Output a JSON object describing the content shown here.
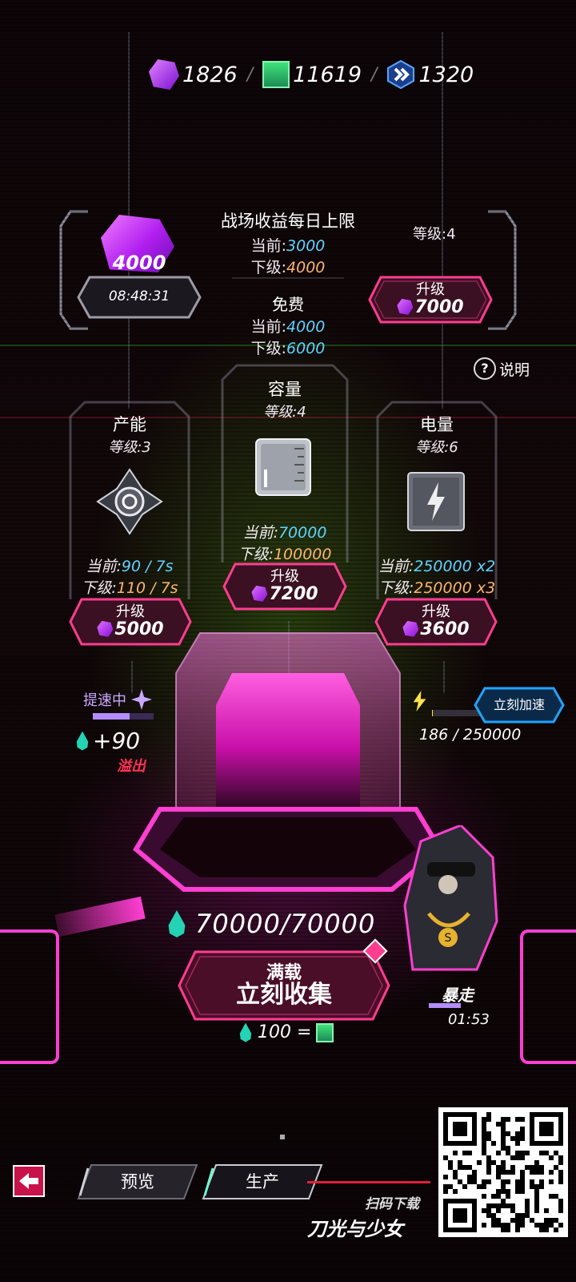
{
  "resources": {
    "gems": "1826",
    "tickets": "11619",
    "chips": "1320",
    "sep": "/"
  },
  "battlefield": {
    "title": "战场收益每日上限",
    "cur_label": "当前:",
    "cur_value": "3000",
    "next_label": "下级:",
    "next_value": "4000",
    "free_label": "免费",
    "free_cur_label": "当前:",
    "free_cur_value": "4000",
    "free_next_label": "下级:",
    "free_next_value": "6000",
    "level": "等级:4",
    "gem_amount": "4000",
    "timer": "08:48:31",
    "upgrade_label": "升级",
    "upgrade_cost": "7000"
  },
  "help_label": "说明",
  "capacity": {
    "title": "容量",
    "level": "等级:4",
    "cur_label": "当前:",
    "cur_value": "70000",
    "next_label": "下级:",
    "next_value": "100000",
    "upgrade_label": "升级",
    "upgrade_cost": "7200"
  },
  "production": {
    "title": "产能",
    "level": "等级:3",
    "cur_label": "当前:",
    "cur_value": "90 / 7s",
    "next_label": "下级:",
    "next_value": "110 / 7s",
    "upgrade_label": "升级",
    "upgrade_cost": "5000",
    "boost_label": "提速中",
    "overflow_amount": "+90",
    "overflow_label": "溢出",
    "boost_level": 0.6
  },
  "power": {
    "title": "电量",
    "level": "等级:6",
    "cur_label": "当前:",
    "cur_value": "250000 x2",
    "next_label": "下级:",
    "next_value": "250000 x3",
    "upgrade_label": "升级",
    "upgrade_cost": "3600",
    "accelerate_label": "立刻加速",
    "progress_text": "186 / 250000",
    "progress_level": 0.0007
  },
  "storage": {
    "amount": "70000/70000",
    "collect_top": "满载",
    "collect_main": "立刻收集",
    "rate": "100 ="
  },
  "character": {
    "status": "暴走",
    "timer": "01:53"
  },
  "bottom_nav": {
    "back_icon": "back-arrow-icon",
    "tab_preview": "预览",
    "tab_production": "生产"
  },
  "promo": {
    "scan_text": "扫码下载",
    "game_title": "刀光与少女"
  },
  "colors": {
    "accent_pink": "#ff3d8f",
    "accent_cyan": "#5fd3ff",
    "accent_orange": "#ffb56a",
    "gem_purple": "#b02cf0",
    "drop_teal": "#23d3b4"
  }
}
